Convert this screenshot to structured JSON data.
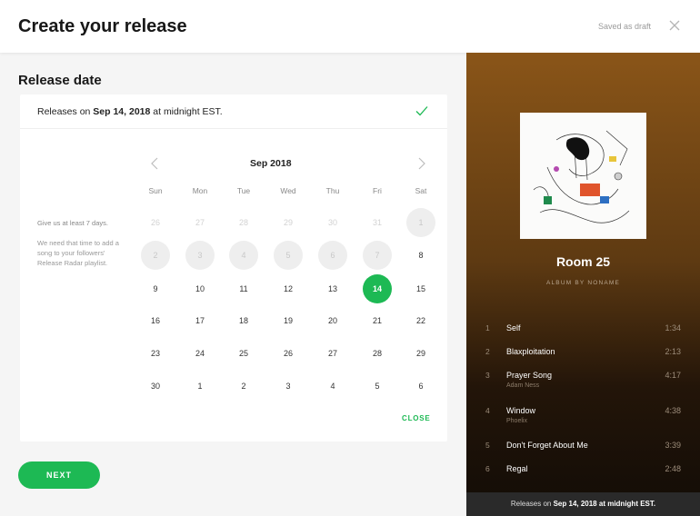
{
  "header": {
    "title": "Create your release",
    "draft_status": "Saved as draft"
  },
  "release_date": {
    "section_title": "Release date",
    "summary_prefix": "Releases on",
    "summary_date": "Sep 14, 2018",
    "summary_suffix": "at midnight EST."
  },
  "hint": {
    "title": "Give us at least 7 days.",
    "body": "We need that time to add a song to your followers' Release Radar playlist."
  },
  "calendar": {
    "month_label": "Sep 2018",
    "weekdays": [
      "Sun",
      "Mon",
      "Tue",
      "Wed",
      "Thu",
      "Fri",
      "Sat"
    ],
    "weeks": [
      [
        {
          "d": "26",
          "s": "muted"
        },
        {
          "d": "27",
          "s": "muted"
        },
        {
          "d": "28",
          "s": "muted"
        },
        {
          "d": "29",
          "s": "muted"
        },
        {
          "d": "30",
          "s": "muted"
        },
        {
          "d": "31",
          "s": "muted"
        },
        {
          "d": "1",
          "s": "blocked"
        }
      ],
      [
        {
          "d": "2",
          "s": "blocked"
        },
        {
          "d": "3",
          "s": "blocked"
        },
        {
          "d": "4",
          "s": "blocked"
        },
        {
          "d": "5",
          "s": "blocked"
        },
        {
          "d": "6",
          "s": "blocked"
        },
        {
          "d": "7",
          "s": "blocked"
        },
        {
          "d": "8",
          "s": "normal"
        }
      ],
      [
        {
          "d": "9",
          "s": "normal"
        },
        {
          "d": "10",
          "s": "normal"
        },
        {
          "d": "11",
          "s": "normal"
        },
        {
          "d": "12",
          "s": "normal"
        },
        {
          "d": "13",
          "s": "normal"
        },
        {
          "d": "14",
          "s": "selected"
        },
        {
          "d": "15",
          "s": "normal"
        }
      ],
      [
        {
          "d": "16",
          "s": "normal"
        },
        {
          "d": "17",
          "s": "normal"
        },
        {
          "d": "18",
          "s": "normal"
        },
        {
          "d": "19",
          "s": "normal"
        },
        {
          "d": "20",
          "s": "normal"
        },
        {
          "d": "21",
          "s": "normal"
        },
        {
          "d": "22",
          "s": "normal"
        }
      ],
      [
        {
          "d": "23",
          "s": "normal"
        },
        {
          "d": "24",
          "s": "normal"
        },
        {
          "d": "25",
          "s": "normal"
        },
        {
          "d": "26",
          "s": "normal"
        },
        {
          "d": "27",
          "s": "normal"
        },
        {
          "d": "28",
          "s": "normal"
        },
        {
          "d": "29",
          "s": "normal"
        }
      ],
      [
        {
          "d": "30",
          "s": "normal"
        },
        {
          "d": "1",
          "s": "normal"
        },
        {
          "d": "2",
          "s": "normal"
        },
        {
          "d": "3",
          "s": "normal"
        },
        {
          "d": "4",
          "s": "normal"
        },
        {
          "d": "5",
          "s": "normal"
        },
        {
          "d": "6",
          "s": "normal"
        }
      ]
    ],
    "close_label": "CLOSE"
  },
  "actions": {
    "next_label": "NEXT"
  },
  "preview": {
    "album_title": "Room 25",
    "album_subtitle": "ALBUM BY NONAME",
    "tracks": [
      {
        "num": "1",
        "name": "Self",
        "artist": "",
        "duration": "1:34"
      },
      {
        "num": "2",
        "name": "Blaxploitation",
        "artist": "",
        "duration": "2:13"
      },
      {
        "num": "3",
        "name": "Prayer Song",
        "artist": "Adam Ness",
        "duration": "4:17"
      },
      {
        "num": "4",
        "name": "Window",
        "artist": "Phoelix",
        "duration": "4:38"
      },
      {
        "num": "5",
        "name": "Don't Forget About Me",
        "artist": "",
        "duration": "3:39"
      },
      {
        "num": "6",
        "name": "Regal",
        "artist": "",
        "duration": "2:48"
      }
    ],
    "footer_prefix": "Releases on",
    "footer_date": "Sep 14, 2018",
    "footer_suffix": "at midnight EST."
  },
  "icons": {
    "close": "close-icon",
    "check": "checkmark-icon",
    "prev": "chevron-left-icon",
    "next": "chevron-right-icon"
  },
  "colors": {
    "accent": "#1db954",
    "blocked_day": "#eeeeee"
  }
}
